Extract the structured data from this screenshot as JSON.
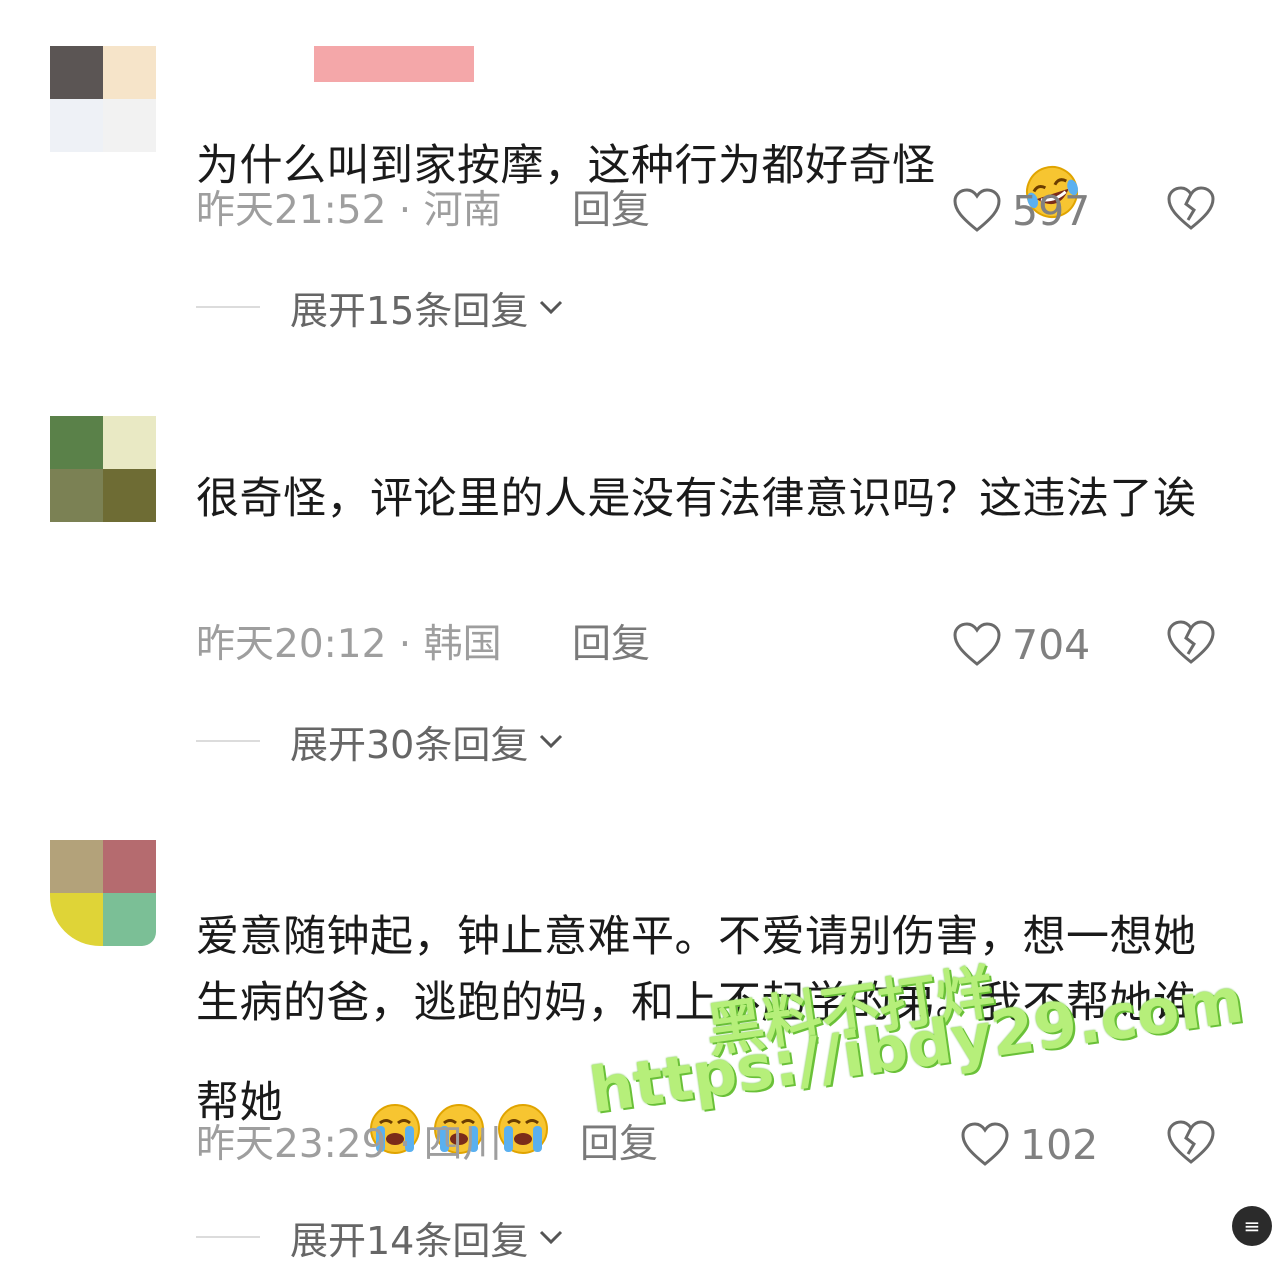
{
  "comments": [
    {
      "avatar_colors": [
        "#5b5554",
        "#f6e4c9",
        "#eef1f6",
        "#f2f2f2"
      ],
      "text": "为什么叫到家按摩，这种行为都好奇怪",
      "emoji": "rolling-on-floor-laughing",
      "time_location": "昨天21:52 · 河南",
      "reply_label": "回复",
      "likes": "597",
      "expand_label": "展开15条回复"
    },
    {
      "avatar_colors": [
        "#5a8149",
        "#e9e9c4",
        "#7b8154",
        "#6e6c34"
      ],
      "text": "很奇怪，评论里的人是没有法律意识吗？这违法了诶",
      "time_location": "昨天20:12 · 韩国",
      "reply_label": "回复",
      "likes": "704",
      "expand_label": "展开30条回复"
    },
    {
      "avatar_colors": [
        "#b3a27a",
        "#b56b6f",
        "#dfd437",
        "#7bbf96"
      ],
      "text": "爱意随钟起，钟止意难平。不爱请别伤害，想一想她生病的爸，逃跑的妈，和上不起学的弟。我不帮她谁帮她",
      "emoji": "loudly-crying-face",
      "emoji_count": 3,
      "time_location": "昨天23:29 · 四川",
      "reply_label": "回复",
      "likes": "102",
      "expand_label": "展开14条回复"
    }
  ],
  "watermark": {
    "line1": "黑料不打烊",
    "line2": "https://ibdy29.com"
  },
  "colors": {
    "text": "#1a1a1a",
    "meta": "#9e9e9e",
    "watermark": "#b6ef7a"
  },
  "icons": {
    "like": "heart-outline-icon",
    "dislike": "broken-heart-icon",
    "expand": "chevron-down-icon"
  }
}
